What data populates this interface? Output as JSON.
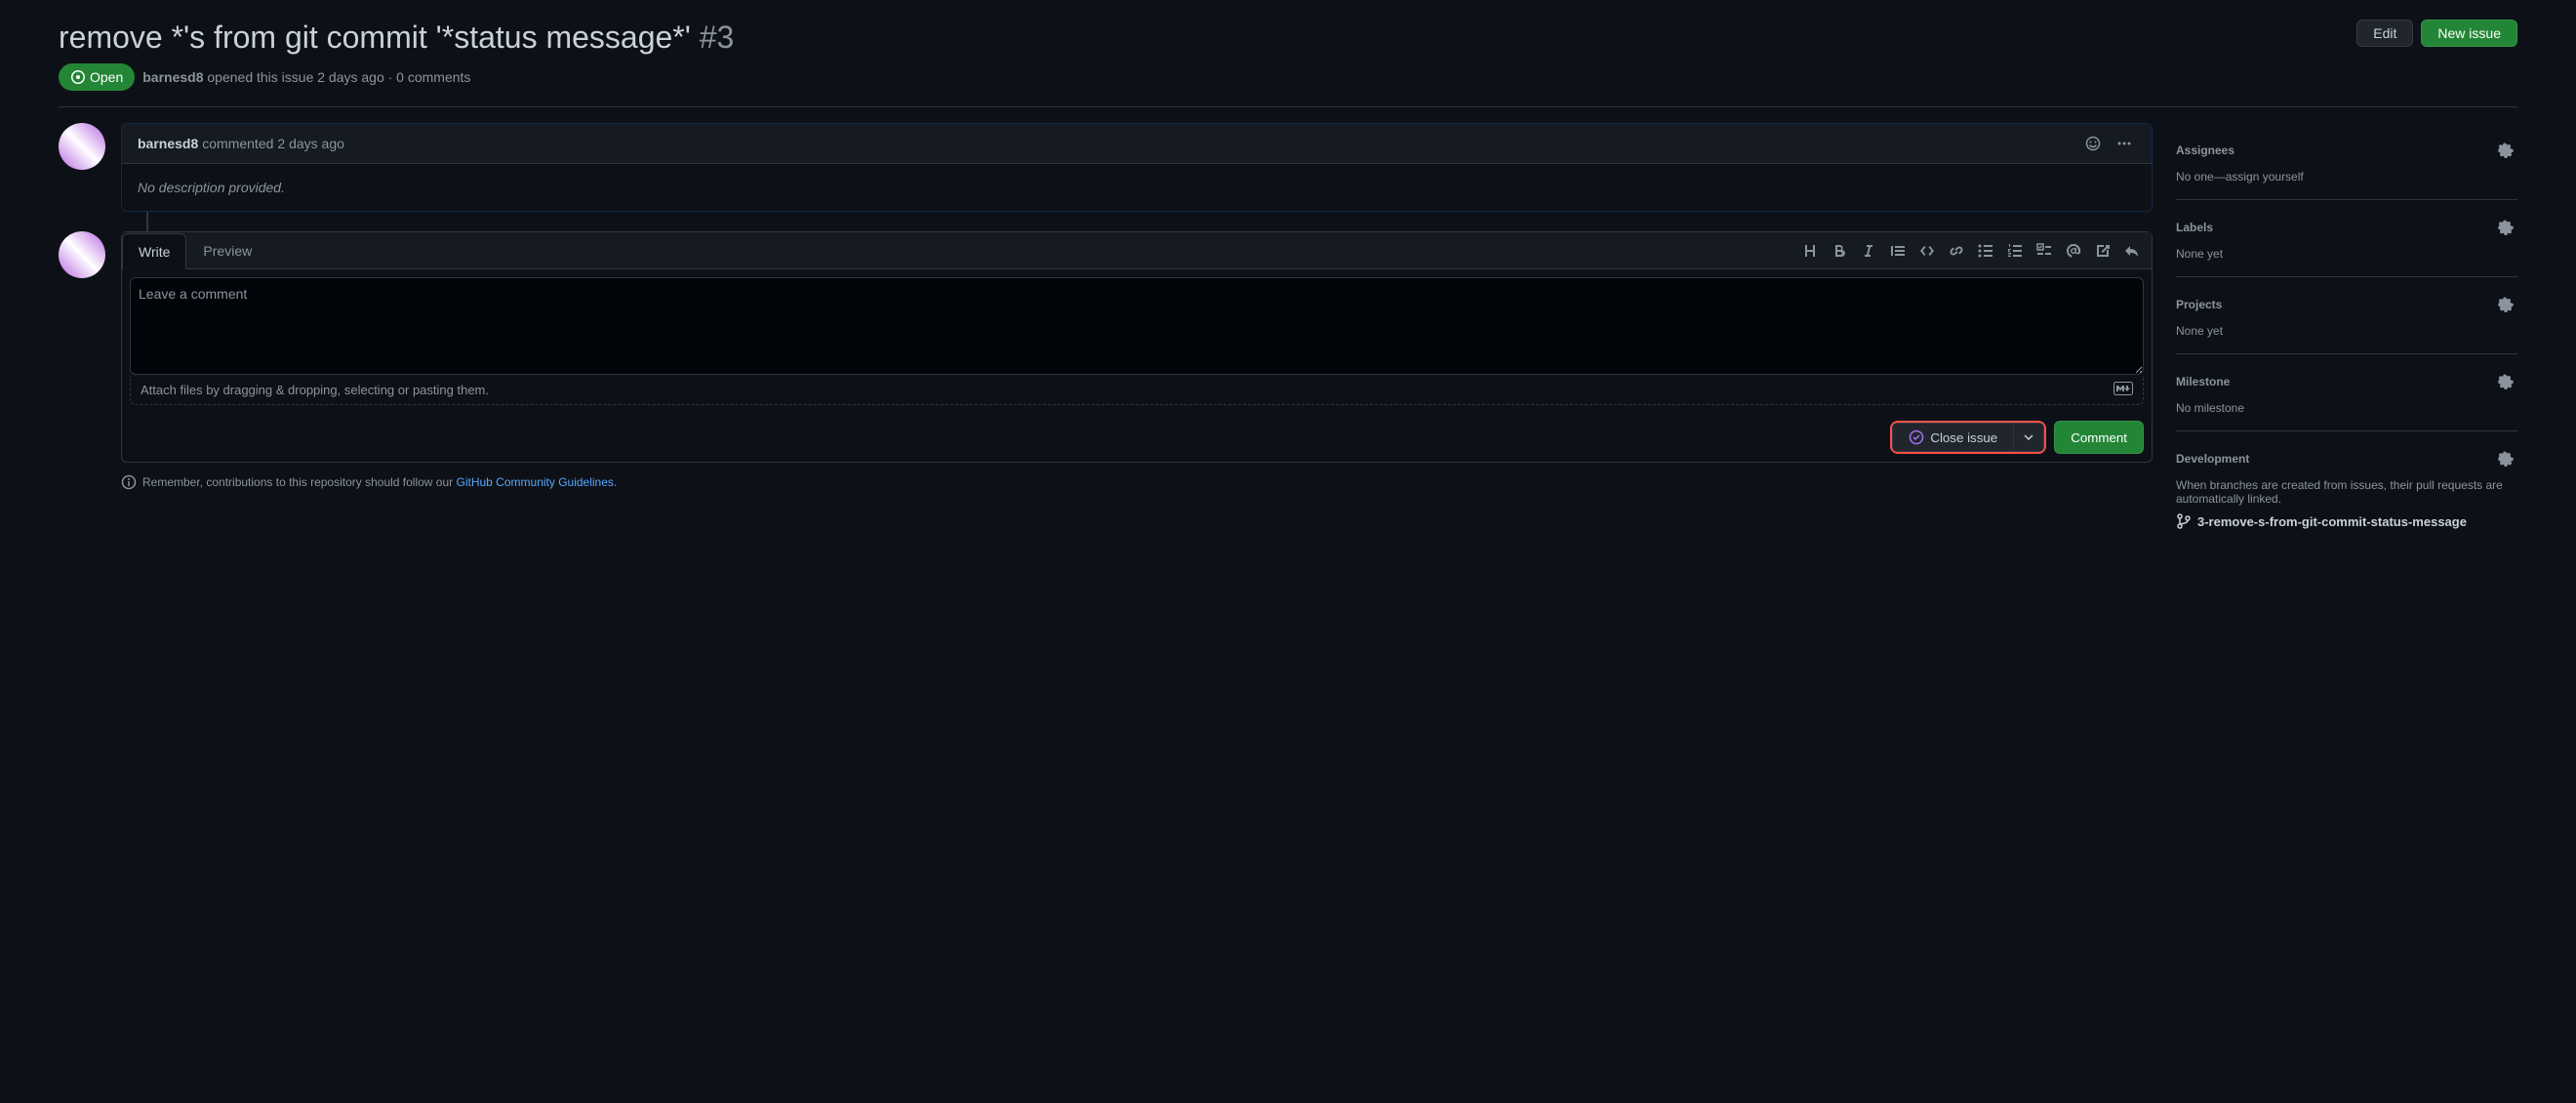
{
  "header": {
    "title": "remove *'s from git commit '*status message*'",
    "number": "#3",
    "edit": "Edit",
    "new_issue": "New issue"
  },
  "meta": {
    "state": "Open",
    "author": "barnesd8",
    "summary": " opened this issue 2 days ago · 0 comments"
  },
  "comment": {
    "author": "barnesd8",
    "action": " commented ",
    "time": "2 days ago",
    "body": "No description provided."
  },
  "compose": {
    "write_tab": "Write",
    "preview_tab": "Preview",
    "placeholder": "Leave a comment",
    "attach_hint": "Attach files by dragging & dropping, selecting or pasting them.",
    "close_label": "Close issue",
    "comment_label": "Comment"
  },
  "guidelines": {
    "prefix": "Remember, contributions to this repository should follow our ",
    "link": "GitHub Community Guidelines",
    "suffix": "."
  },
  "sidebar": {
    "assignees": {
      "title": "Assignees",
      "value": "No one—assign yourself"
    },
    "labels": {
      "title": "Labels",
      "value": "None yet"
    },
    "projects": {
      "title": "Projects",
      "value": "None yet"
    },
    "milestone": {
      "title": "Milestone",
      "value": "No milestone"
    },
    "development": {
      "title": "Development",
      "desc": "When branches are created from issues, their pull requests are automatically linked.",
      "branch": "3-remove-s-from-git-commit-status-message"
    }
  }
}
